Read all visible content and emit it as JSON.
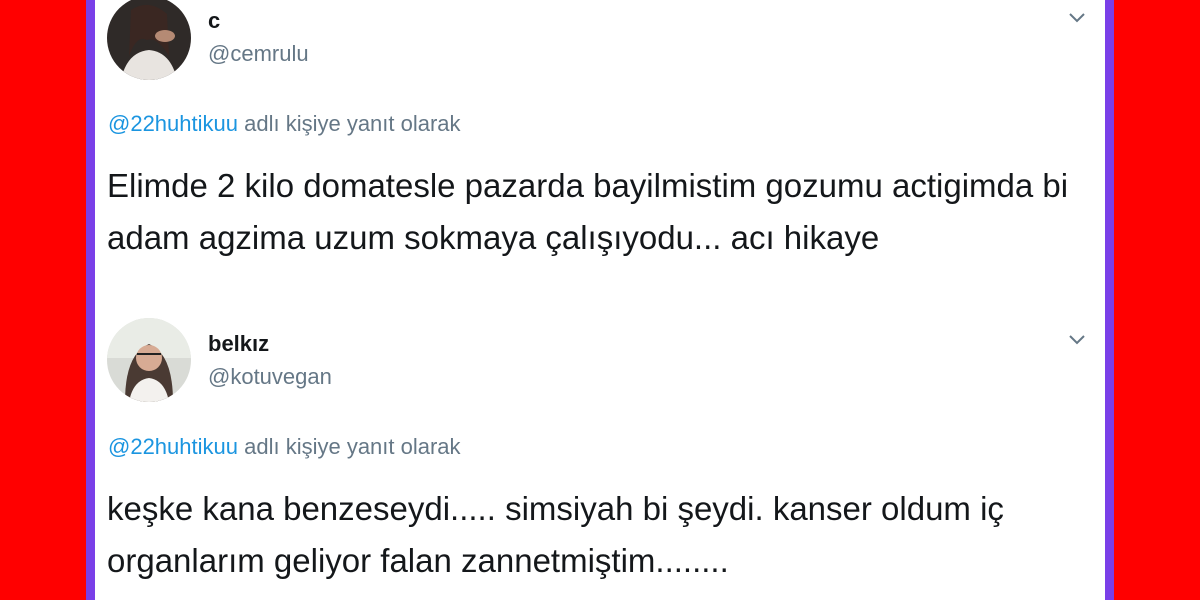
{
  "tweets": [
    {
      "name": "c",
      "handle": "@cemrulu",
      "reply_mention": "@22huhtikuu",
      "reply_suffix": "adlı kişiye yanıt olarak",
      "text": "Elimde 2 kilo domatesle pazarda bayilmistim gozumu actigimda bi adam agzima uzum sokmaya çalışıyodu... acı hikaye"
    },
    {
      "name": "belkız",
      "handle": "@kotuvegan",
      "reply_mention": "@22huhtikuu",
      "reply_suffix": "adlı kişiye yanıt olarak",
      "text": "keşke kana benzeseydi..... simsiyah bi şeydi. kanser oldum iç organlarım geliyor falan zannetmiştim........"
    }
  ],
  "colors": {
    "background": "#ff0000",
    "frame": "#7a3fe8",
    "card": "#ffffff",
    "mention": "#1b95e0",
    "secondary_text": "#657786",
    "primary_text": "#14171a"
  },
  "icons": {
    "caret": "chevron-down-icon"
  }
}
